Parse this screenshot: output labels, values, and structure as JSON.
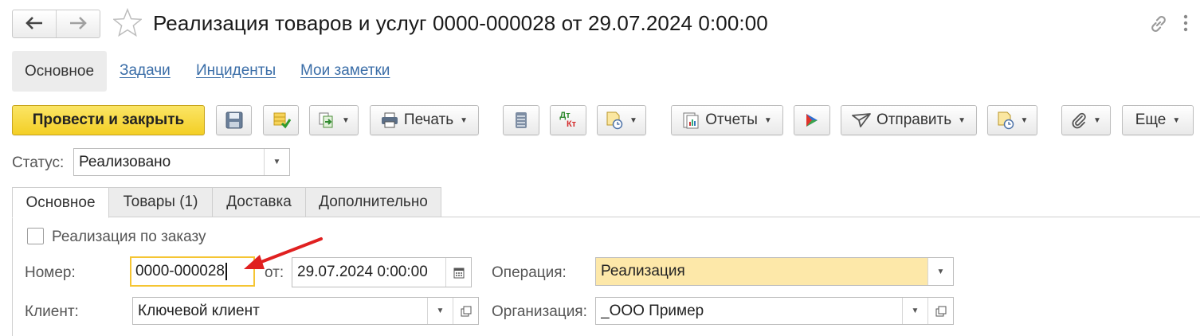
{
  "window": {
    "title": "Реализация товаров и услуг 0000-000028 от 29.07.2024 0:00:00",
    "nav_back": "🡐",
    "nav_forward": "🡒",
    "icons": [
      "back-arrow-icon",
      "forward-arrow-icon",
      "favorite-star-icon",
      "link-icon",
      "more-vertical-icon"
    ]
  },
  "sections": {
    "active": "Основное",
    "links": [
      "Задачи",
      "Инциденты",
      "Мои заметки"
    ]
  },
  "toolbar": {
    "post_and_close": "Провести и закрыть",
    "print": "Печать",
    "reports": "Отчеты",
    "send": "Отправить",
    "more": "Еще",
    "dtkt_top": "Дт",
    "dtkt_bottom": "Кт",
    "accent": "#f3cf25"
  },
  "status": {
    "label": "Статус:",
    "value": "Реализовано"
  },
  "tabs": [
    "Основное",
    "Товары (1)",
    "Доставка",
    "Дополнительно"
  ],
  "form": {
    "by_order_label": "Реализация по заказу",
    "by_order_checked": false,
    "number_label": "Номер:",
    "number_value": "0000-000028",
    "date_label": "от:",
    "date_value": "29.07.2024  0:00:00",
    "operation_label": "Операция:",
    "operation_value": "Реализация",
    "client_label": "Клиент:",
    "client_value": "Ключевой клиент",
    "organization_label": "Организация:",
    "organization_value": "_ООО Пример",
    "focus_color": "#f5c533",
    "highlight_color": "#fde8a9",
    "annotation_arrow_color": "#e02020"
  }
}
